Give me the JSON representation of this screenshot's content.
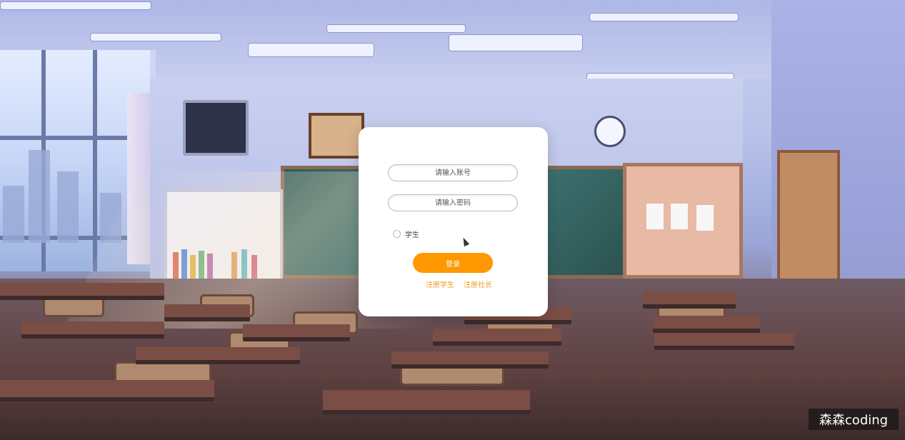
{
  "login_form": {
    "username_placeholder": "请输入账号",
    "password_placeholder": "请输入密码",
    "role_option": "学生",
    "login_label": "登录",
    "register_student_label": "注册学生",
    "register_president_label": "注册社长"
  },
  "watermark": {
    "text": "森森coding"
  },
  "colors": {
    "accent": "#ff9800",
    "link": "#f09a2a",
    "card": "#ffffff"
  }
}
